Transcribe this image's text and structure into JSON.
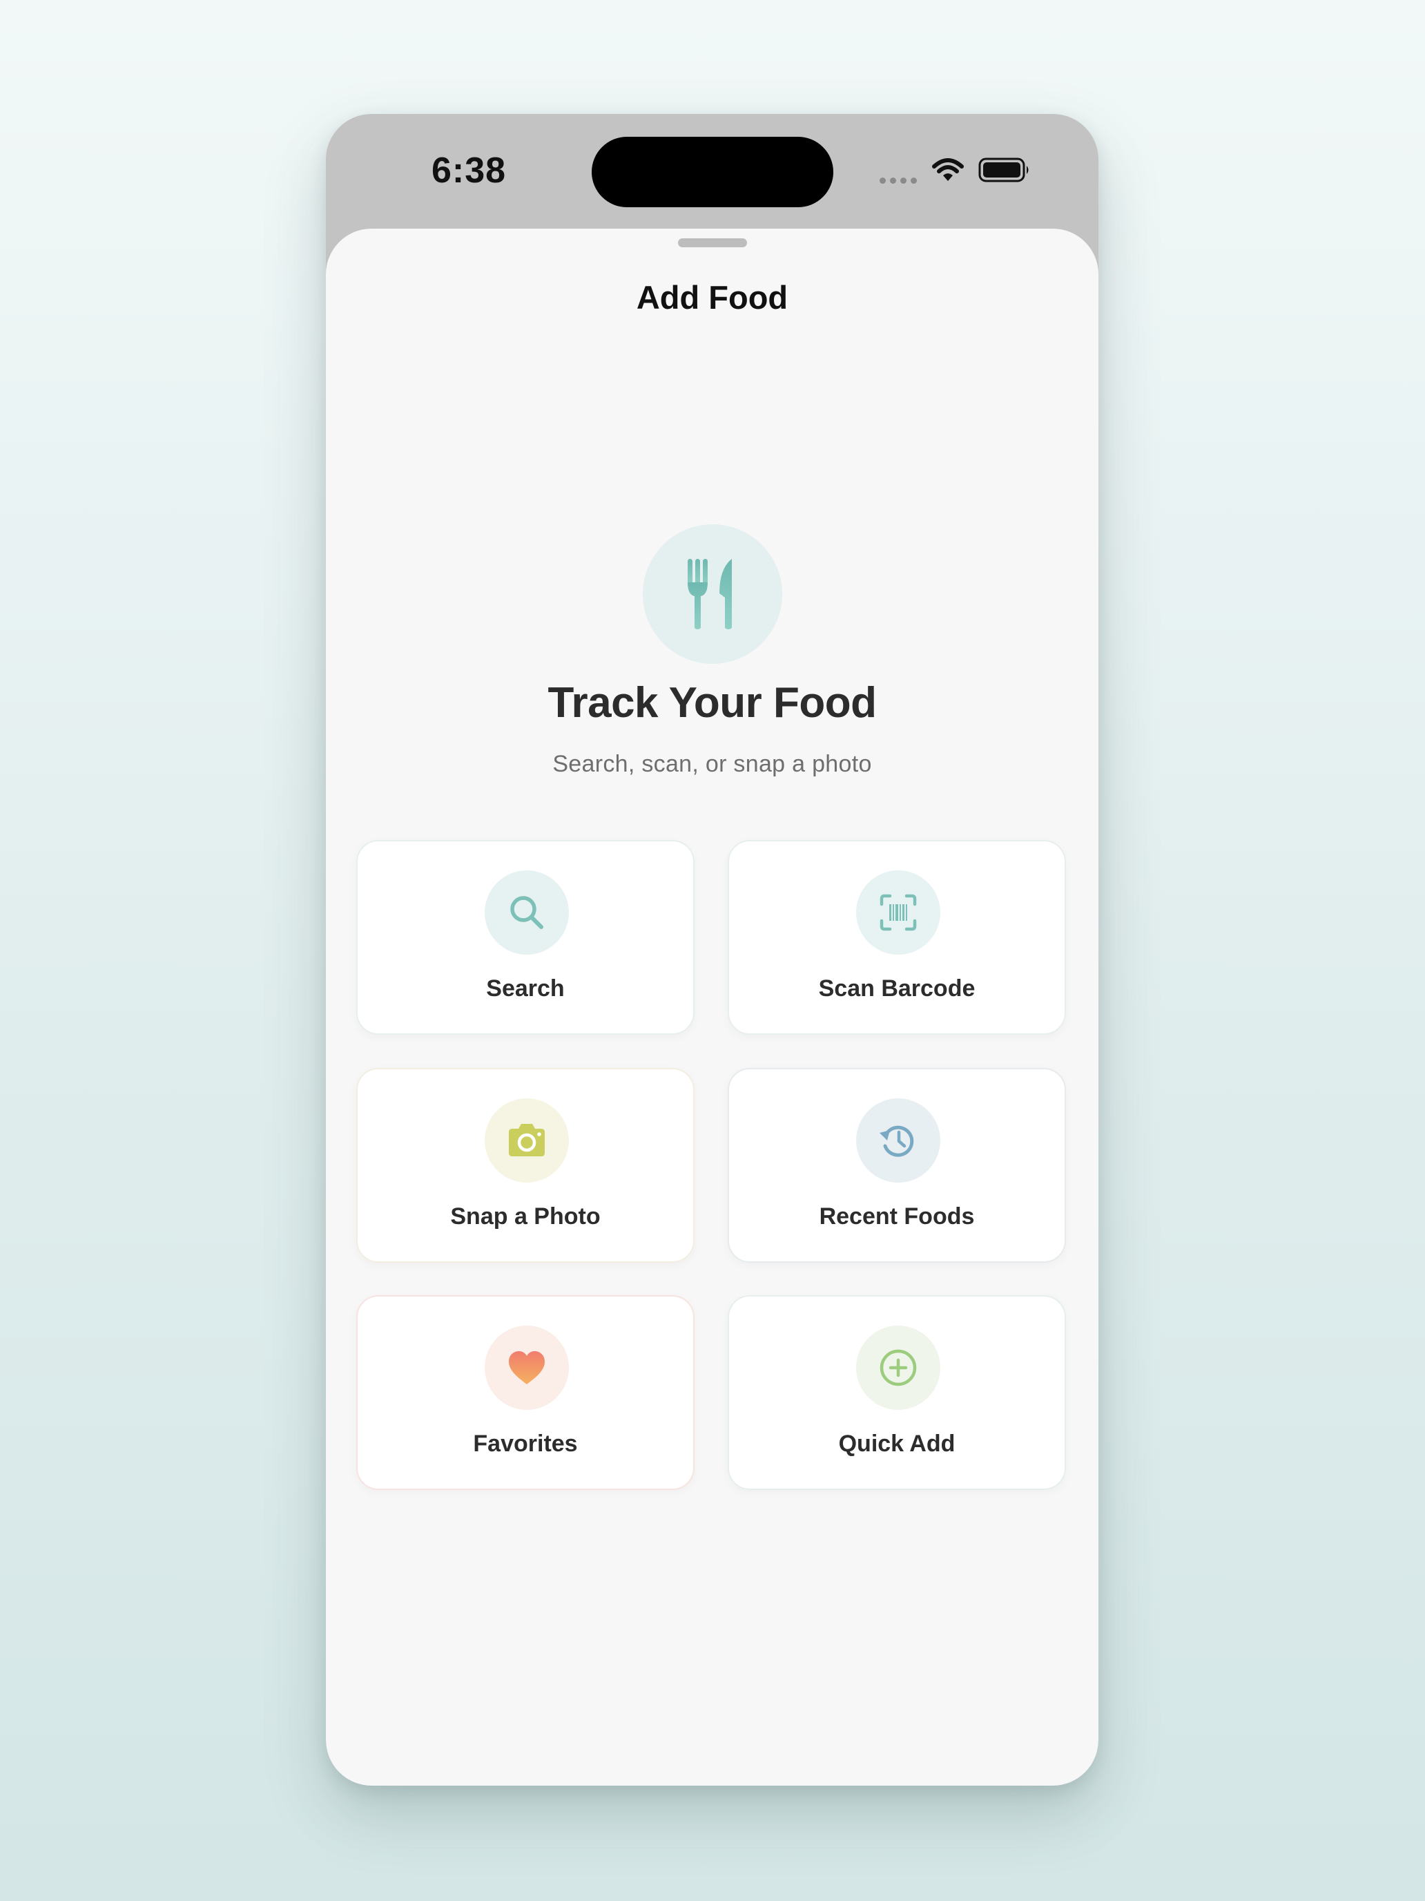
{
  "status_bar": {
    "time": "6:38"
  },
  "sheet": {
    "title": "Add Food"
  },
  "hero": {
    "icon": "fork-knife-icon",
    "title": "Track Your Food",
    "subtitle": "Search, scan, or snap a photo"
  },
  "options": [
    {
      "label": "Search",
      "icon": "magnifying-glass-icon",
      "tint": "#e6f2f1",
      "color": "#7cc0b7"
    },
    {
      "label": "Scan Barcode",
      "icon": "barcode-scanner-icon",
      "tint": "#e6f3f2",
      "color": "#7cc0b7"
    },
    {
      "label": "Snap a Photo",
      "icon": "camera-icon",
      "tint": "#f6f5e3",
      "color": "#c9ce5c"
    },
    {
      "label": "Recent Foods",
      "icon": "history-clock-icon",
      "tint": "#e8eff3",
      "color": "#7aa9c3"
    },
    {
      "label": "Favorites",
      "icon": "heart-icon",
      "tint": "#fbeee8",
      "color": "#f07d6e"
    },
    {
      "label": "Quick Add",
      "icon": "plus-circle-icon",
      "tint": "#eff5ea",
      "color": "#9ccc7e"
    }
  ]
}
